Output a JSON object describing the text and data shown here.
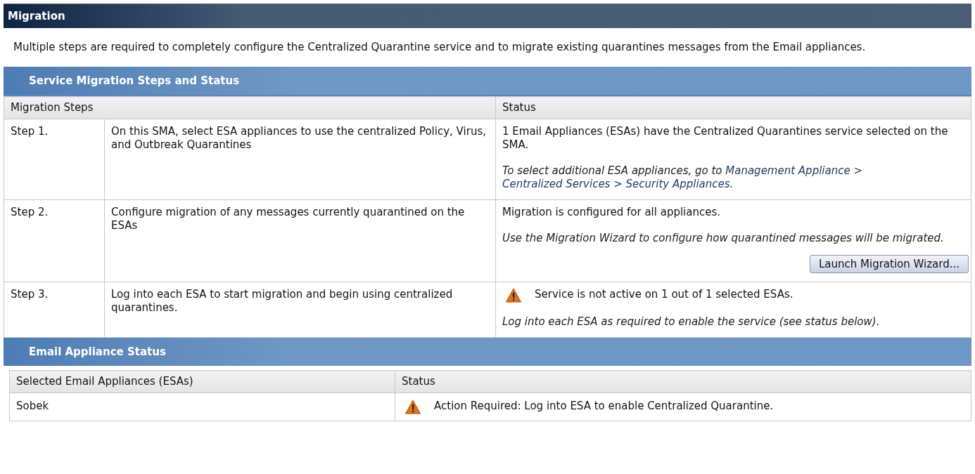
{
  "title": "Migration",
  "intro": "Multiple steps are required to completely configure the Centralized Quarantine service and to migrate existing quarantines messages from the Email appliances.",
  "steps_section": {
    "title": "Service Migration Steps and Status",
    "columns": [
      "Migration Steps",
      "Status"
    ],
    "rows": [
      {
        "step": "Step 1.",
        "description": "On this SMA, select ESA appliances to use the centralized Policy, Virus, and Outbreak Quarantines",
        "warning": false,
        "status": "1 Email Appliances (ESAs) have the Centralized Quarantines service selected on the SMA.",
        "note": {
          "prefix": "To select additional ESA appliances, go to ",
          "links": [
            "Management Appliance",
            "Centralized Services",
            "Security Appliances"
          ],
          "separator": " > ",
          "suffix": "."
        }
      },
      {
        "step": "Step 2.",
        "description": "Configure migration of any messages currently quarantined on the ESAs",
        "warning": false,
        "status": "Migration is configured for all appliances.",
        "note": {
          "prefix": "Use the Migration Wizard to configure how quarantined messages will be migrated."
        },
        "button": "Launch Migration Wizard..."
      },
      {
        "step": "Step 3.",
        "description": "Log into each ESA to start migration and begin using centralized quarantines.",
        "warning": true,
        "status": "Service is not active on 1 out of 1 selected ESAs.",
        "note": {
          "prefix": "Log into each ESA as required to enable the service (see status below)."
        }
      }
    ]
  },
  "appliance_section": {
    "title": "Email Appliance Status",
    "columns": [
      "Selected Email Appliances (ESAs)",
      "Status"
    ],
    "rows": [
      {
        "name": "Sobek",
        "warning": true,
        "status": "Action Required: Log into ESA to enable Centralized Quarantine."
      }
    ]
  }
}
